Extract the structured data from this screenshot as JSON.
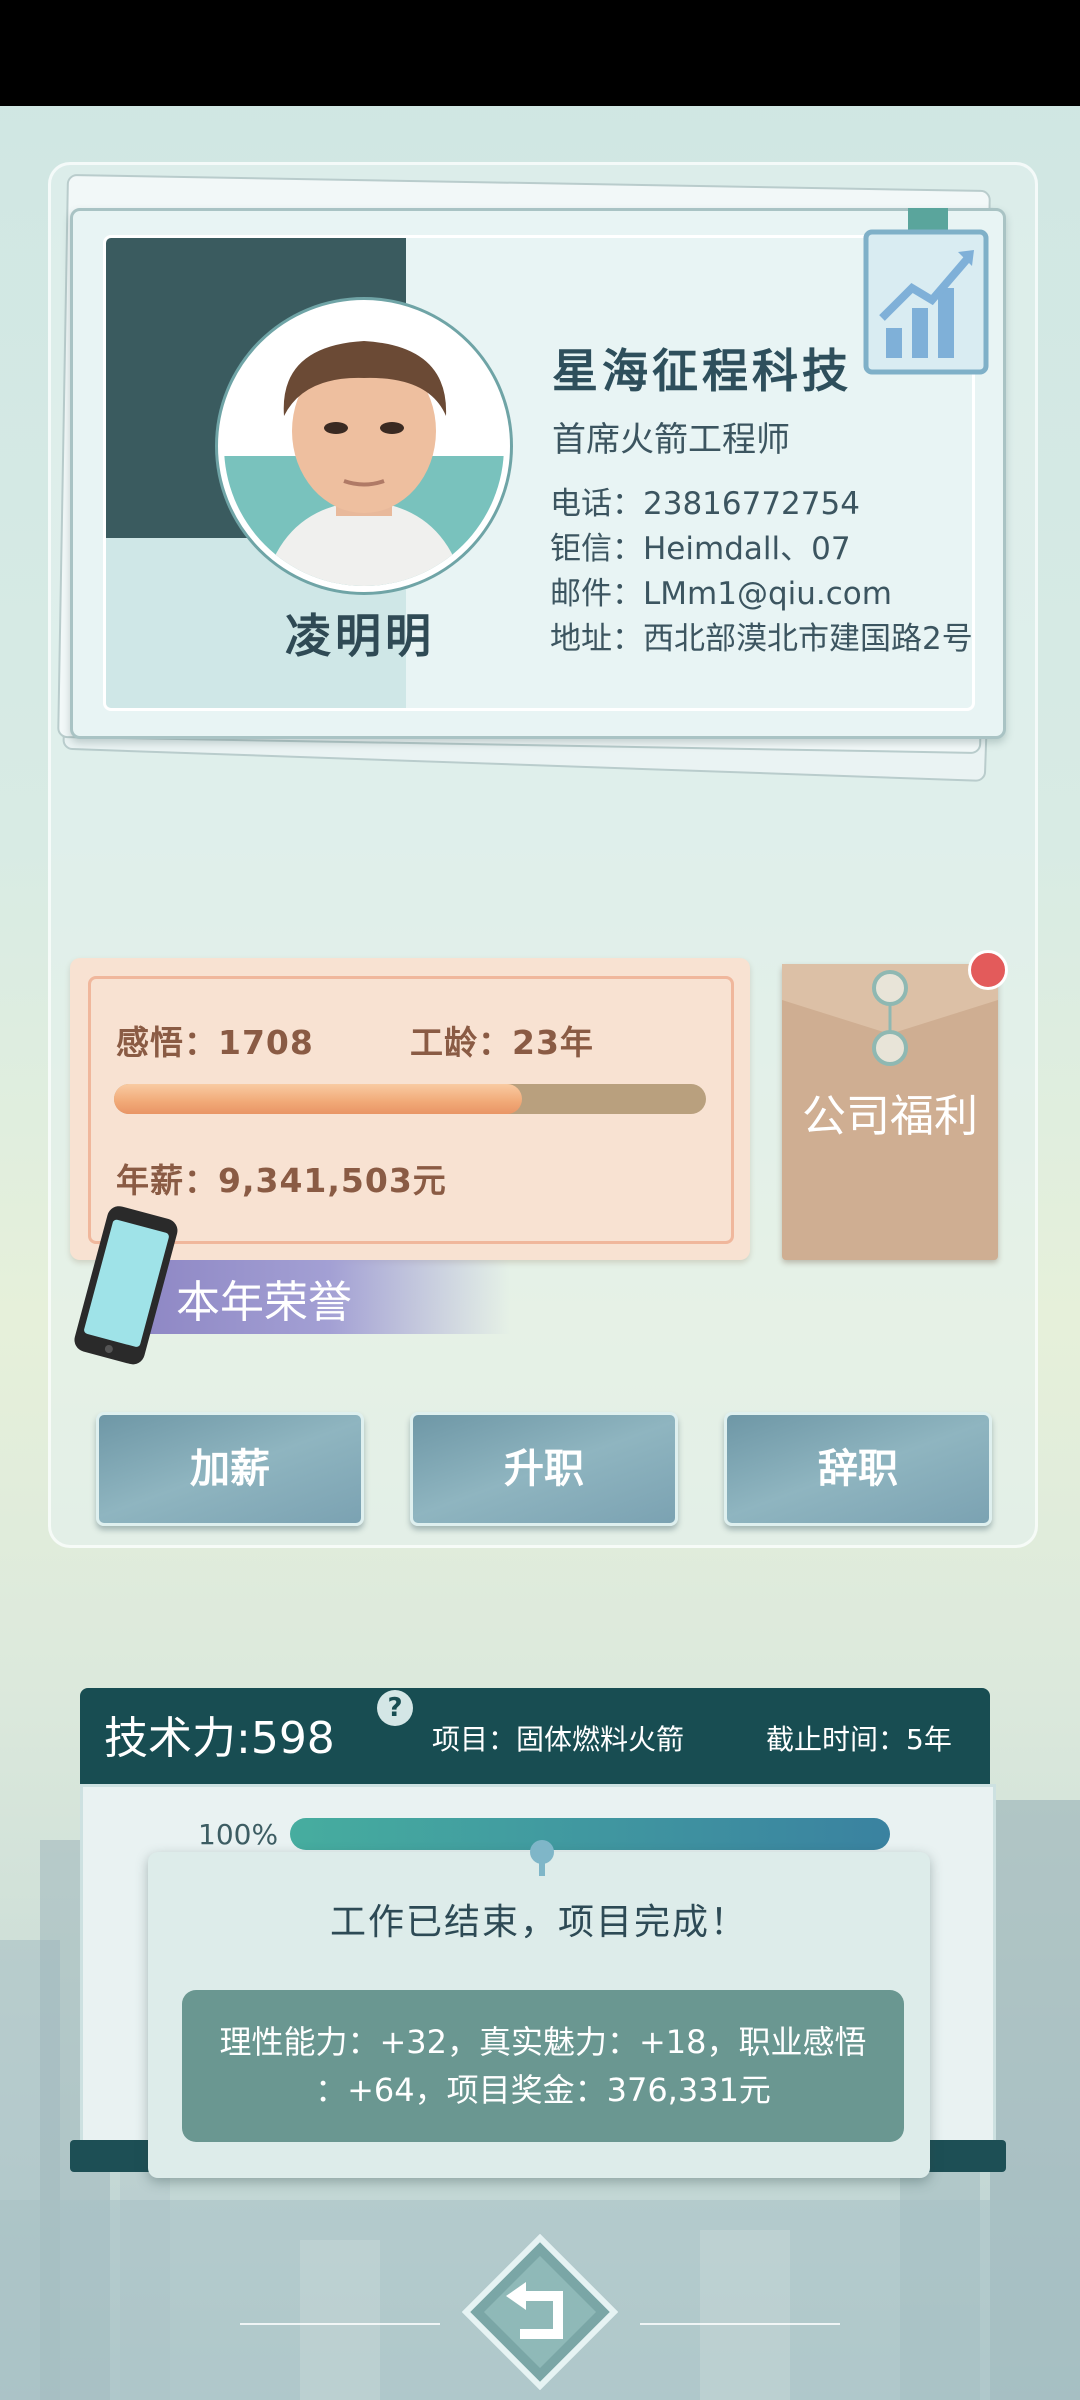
{
  "profile": {
    "name": "凌明明",
    "company": "星海征程科技",
    "job_title": "首席火箭工程师",
    "phone": "电话：23816772754",
    "chat": "钜信：Heimdall、07",
    "email": "邮件：LMm1@qiu.com",
    "address": "地址：西北部漠北市建国路2号"
  },
  "stats": {
    "insight": "感悟：1708",
    "seniority": "工龄：23年",
    "salary": "年薪：9,341,503元",
    "progress_fraction": 0.69
  },
  "welfare_label": "公司福利",
  "honor_label": "本年荣誉",
  "actions": {
    "raise": "加薪",
    "promote": "升职",
    "resign": "辞职"
  },
  "project": {
    "tech_power": "技术力:598",
    "help_mark": "?",
    "name": "项目：固体燃料火箭",
    "deadline": "截止时间：5年",
    "percent": "100%"
  },
  "dialog": {
    "title": "工作已结束，项目完成！",
    "line1": "理性能力：+32，真实魅力：+18，职业感悟",
    "line2": "：+64，项目奖金：376,331元"
  },
  "colors": {
    "accent": "#184d52",
    "salary_bar": "#f1a977",
    "progress": "#46ad9f"
  }
}
